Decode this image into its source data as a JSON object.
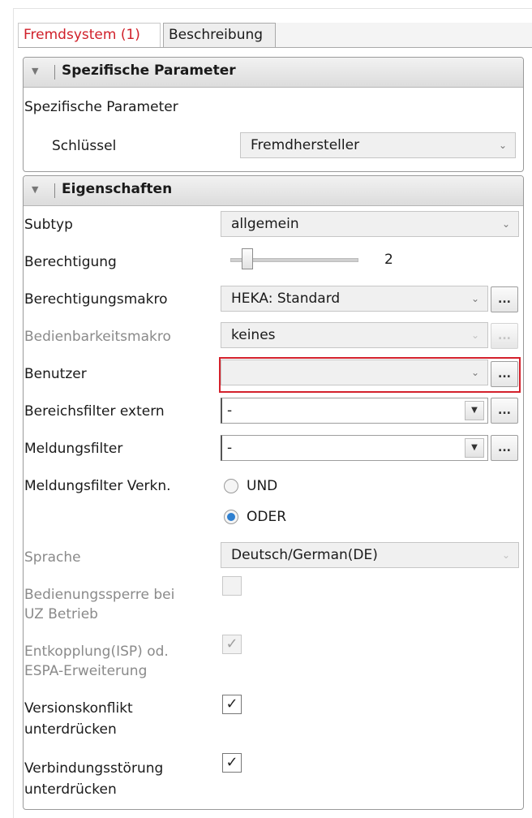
{
  "tabs": [
    {
      "label": "Fremdsystem (1)"
    },
    {
      "label": "Beschreibung"
    }
  ],
  "group1": {
    "title": "Spezifische Parameter",
    "subtitle": "Spezifische Parameter",
    "schluessel_label": "Schlüssel",
    "schluessel_value": "Fremdhersteller"
  },
  "group2": {
    "title": "Eigenschaften",
    "subtyp_label": "Subtyp",
    "subtyp_value": "allgemein",
    "berechtigung_label": "Berechtigung",
    "berechtigung_value": "2",
    "berechtigungsmakro_label": "Berechtigungsmakro",
    "berechtigungsmakro_value": "HEKA: Standard",
    "bedienbarkeitsmakro_label": "Bedienbarkeitsmakro",
    "bedienbarkeitsmakro_value": "keines",
    "benutzer_label": "Benutzer",
    "benutzer_value": "",
    "bereichsfilter_label": "Bereichsfilter extern",
    "bereichsfilter_value": "-",
    "meldungsfilter_label": "Meldungsfilter",
    "meldungsfilter_value": "-",
    "verkn_label": "Meldungsfilter Verkn.",
    "verkn_options": [
      "UND",
      "ODER"
    ],
    "verkn_selected": "ODER",
    "sprache_label": "Sprache",
    "sprache_value": "Deutsch/German(DE)",
    "sperre_label_1": "Bedienungssperre bei",
    "sperre_label_2": "UZ Betrieb",
    "entkopplung_label_1": "Entkopplung(ISP) od.",
    "entkopplung_label_2": "ESPA-Erweiterung",
    "versionskonflikt_label_1": "Versionskonflikt",
    "versionskonflikt_label_2": "unterdrücken",
    "verbindung_label_1": "Verbindungsstörung",
    "verbindung_label_2": "unterdrücken"
  },
  "button_more_label": "...",
  "colors": {
    "active_tab": "#d0202a",
    "highlight_border": "#d4212c",
    "radio_selected": "#2f80d0"
  }
}
